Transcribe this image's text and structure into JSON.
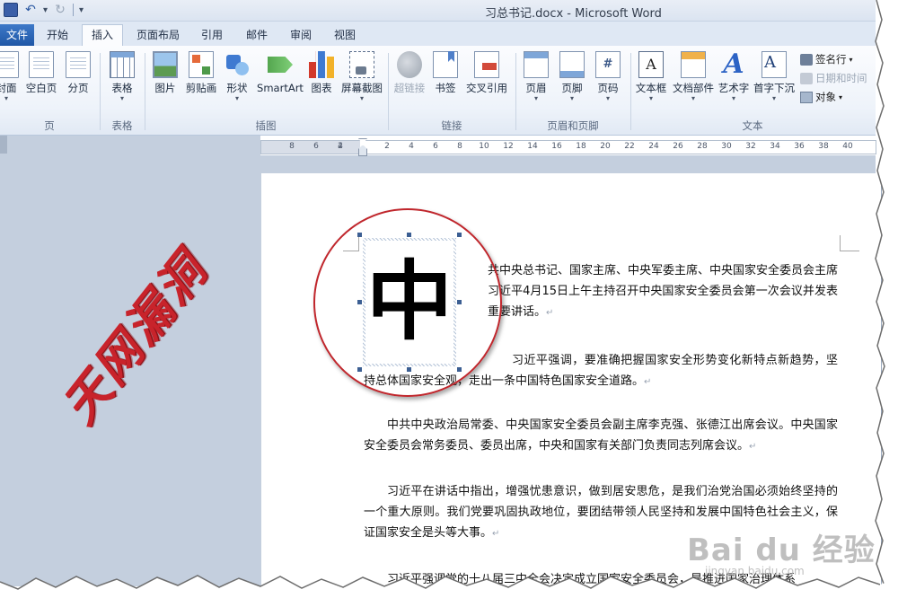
{
  "titlebar": {
    "window_title": "习总书记.docx  -  Microsoft Word"
  },
  "tabs": [
    {
      "label": "文件"
    },
    {
      "label": "开始"
    },
    {
      "label": "插入",
      "active": true
    },
    {
      "label": "页面布局"
    },
    {
      "label": "引用"
    },
    {
      "label": "邮件"
    },
    {
      "label": "审阅"
    },
    {
      "label": "视图"
    }
  ],
  "ribbon": {
    "groups": {
      "pages": "页",
      "tables": "表格",
      "illustrations": "插图",
      "links": "链接",
      "header_footer": "页眉和页脚",
      "text": "文本"
    },
    "buttons": {
      "cover": "封面",
      "blank": "空白页",
      "break": "分页",
      "table": "表格",
      "picture": "图片",
      "clipart": "剪贴画",
      "shapes": "形状",
      "smartart": "SmartArt",
      "chart": "图表",
      "screenshot": "屏幕截图",
      "hyperlink": "超链接",
      "bookmark": "书签",
      "crossref": "交叉引用",
      "header": "页眉",
      "footer": "页脚",
      "pagenum": "页码",
      "textbox": "文本框",
      "quickparts": "文档部件",
      "wordart": "艺术字",
      "dropcap": "首字下沉",
      "signature": "签名行",
      "datetime": "日期和时间",
      "object": "对象"
    }
  },
  "ruler": {
    "ticks": [
      "8",
      "6",
      "4",
      "2",
      "2",
      "4",
      "6",
      "8",
      "10",
      "12",
      "14",
      "16",
      "18",
      "20",
      "22",
      "24",
      "26",
      "28",
      "30",
      "32",
      "34",
      "36",
      "38",
      "40"
    ]
  },
  "document": {
    "drop_char": "中",
    "paragraphs": [
      "共中央总书记、国家主席、中央军委主席、中央国家安全委员会主席习近平4月15日上午主持召开中央国家安全委员会第一次会议并发表重要讲话。",
      "习近平强调，要准确把握国家安全形势变化新特点新趋势，坚持总体国家安全观，走出一条中国特色国家安全道路。",
      "中共中央政治局常委、中央国家安全委员会副主席李克强、张德江出席会议。中央国家安全委员会常务委员、委员出席，中央和国家有关部门负责同志列席会议。",
      "习近平在讲话中指出，增强忧患意识，做到居安思危，是我们治党治国必须始终坚持的一个重大原则。我们党要巩固执政地位，要团结带领人民坚持和发展中国特色社会主义，保证国家安全是头等大事。",
      "习近平强调党的十八届三中全会决定成立国家安全委员会，是推进国家治理体系"
    ],
    "para_mark": "↵"
  },
  "overlay": {
    "calligraphy": "天网漏洞",
    "watermark_brand": "Bai du 经验",
    "watermark_url": "jingyan.baidu.com"
  },
  "colors": {
    "accent_red": "#c0262c",
    "file_tab": "#2a64b6"
  }
}
